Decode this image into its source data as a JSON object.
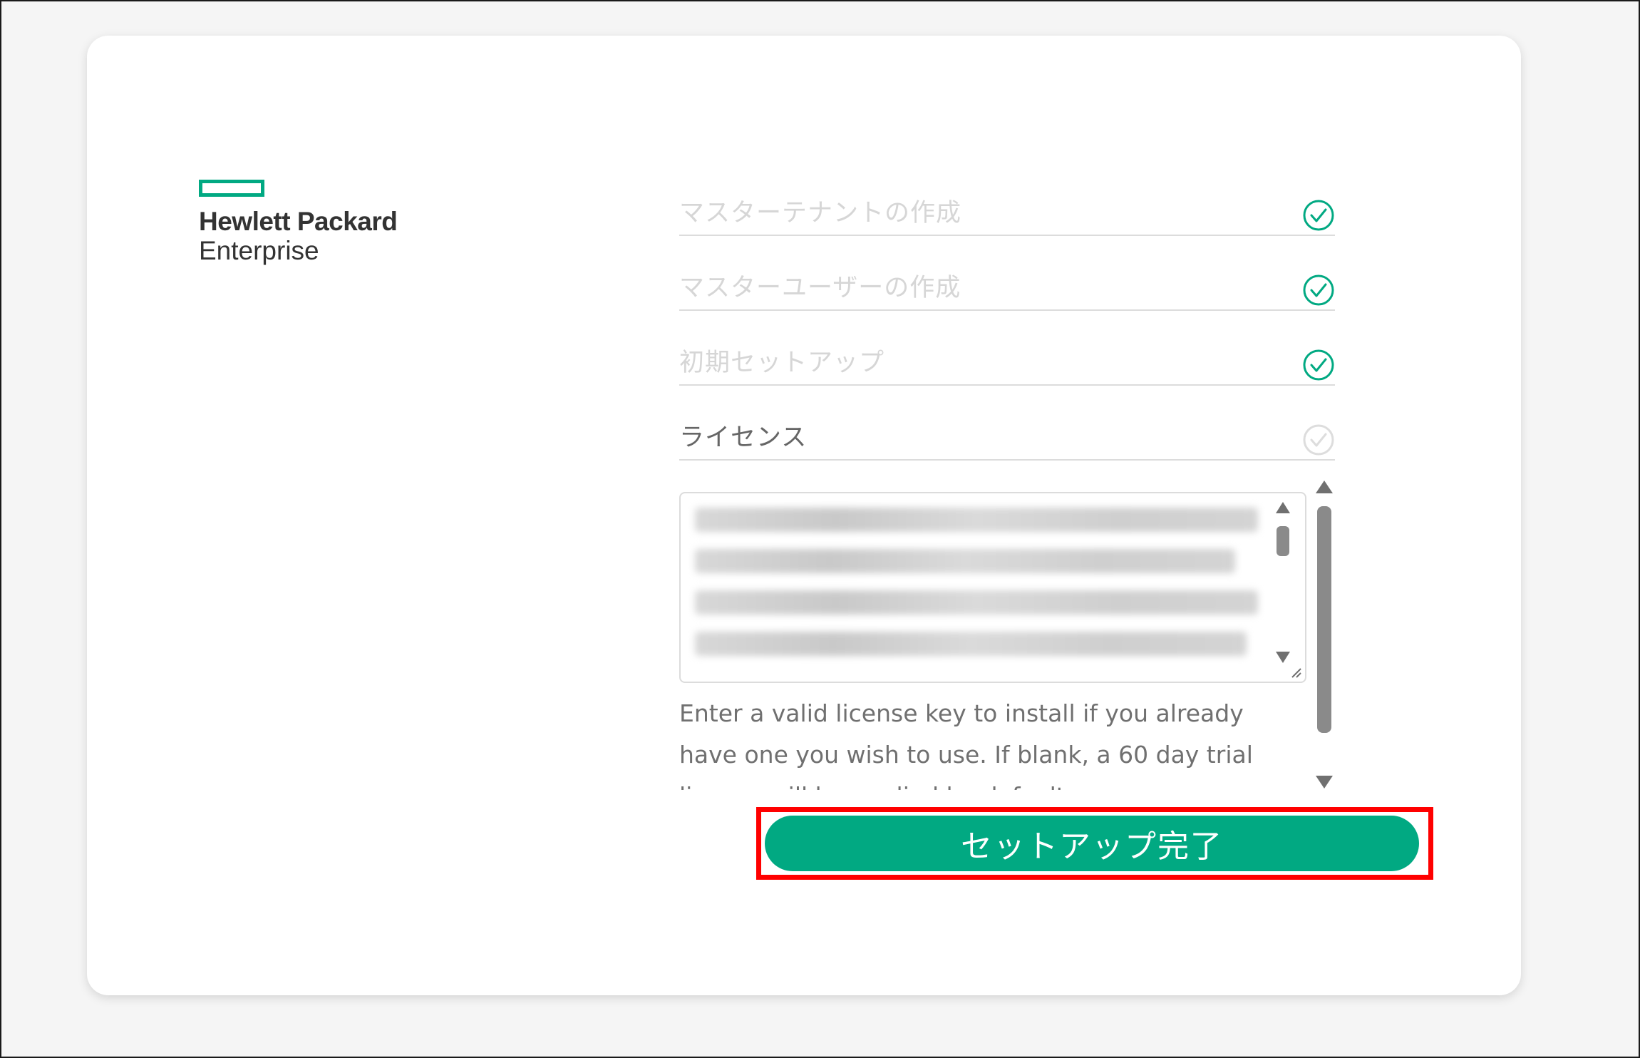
{
  "logo": {
    "line1": "Hewlett Packard",
    "line2": "Enterprise",
    "brand_color": "#01a982",
    "icon": "hpe-element-icon"
  },
  "steps": [
    {
      "label": "マスターテナントの作成",
      "state": "completed",
      "icon": "check-circle-icon"
    },
    {
      "label": "マスターユーザーの作成",
      "state": "completed",
      "icon": "check-circle-icon"
    },
    {
      "label": "初期セットアップ",
      "state": "completed",
      "icon": "check-circle-icon"
    },
    {
      "label": "ライセンス",
      "state": "active",
      "icon": "check-circle-icon"
    }
  ],
  "license": {
    "value_obscured": true,
    "help_text": "Enter a valid license key to install if you already have one you wish to use. If blank, a 60 day trial license will be applied by default."
  },
  "finish_button": {
    "label": "セットアップ完了",
    "color": "#01a982",
    "highlight_color": "#ff0000"
  },
  "colors": {
    "check_done": "#01a982",
    "check_pending": "#dddddd"
  }
}
